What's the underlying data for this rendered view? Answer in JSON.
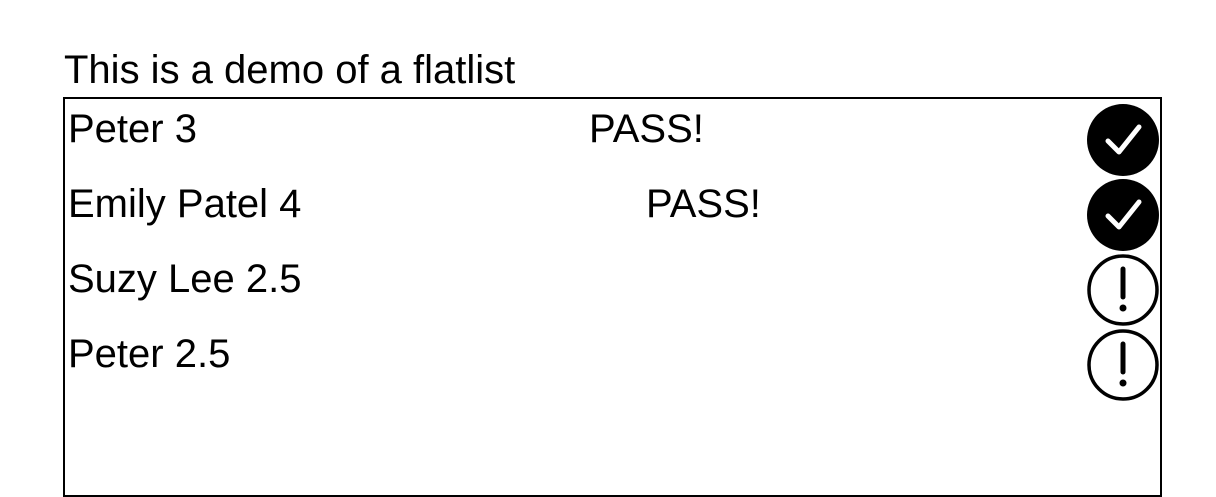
{
  "heading": "This is a demo of a flatlist",
  "rows": [
    {
      "name": "Peter 3",
      "status": "PASS!",
      "icon": "checkmark-circle-filled-icon"
    },
    {
      "name": "Emily Patel 4",
      "status": "PASS!",
      "icon": "checkmark-circle-filled-icon"
    },
    {
      "name": "Suzy Lee 2.5",
      "status": "",
      "icon": "alert-circle-outline-icon"
    },
    {
      "name": "Peter 2.5",
      "status": "",
      "icon": "alert-circle-outline-icon"
    }
  ]
}
